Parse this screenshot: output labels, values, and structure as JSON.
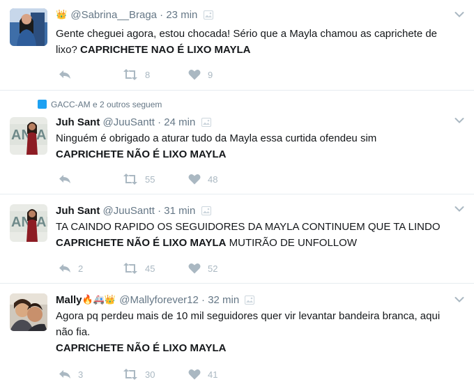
{
  "tweets": [
    {
      "name": "",
      "badges": "👑",
      "handle": "@Sabrina__Braga",
      "separator": "·",
      "time": "23 min",
      "context": "",
      "text_plain": "Gente cheguei agora, estou chocada! Sério que a Mayla chamou as caprichete de lixo? ",
      "text_bold": "CAPRICHETE NAO É LIXO MAYLA",
      "text_after": "",
      "replies": "",
      "retweets": "8",
      "likes": "9"
    },
    {
      "name": "Juh Sant",
      "badges": "",
      "handle": "@JuuSantt",
      "separator": "·",
      "time": "24 min",
      "context": "GACC-AM e 2 outros seguem",
      "text_plain": "Ninguém é obrigado a aturar tudo da Mayla essa curtida ofendeu sim",
      "text_bold": "CAPRICHETE NÃO É LIXO MAYLA",
      "text_after": "",
      "replies": "",
      "retweets": "55",
      "likes": "48"
    },
    {
      "name": "Juh Sant",
      "badges": "",
      "handle": "@JuuSantt",
      "separator": "·",
      "time": "31 min",
      "context": "",
      "text_plain": "TA CAINDO RAPIDO OS SEGUIDORES DA MAYLA CONTINUEM QUE TA LINDO",
      "text_bold": "CAPRICHETE NÃO É LIXO MAYLA",
      "text_after": " MUTIRÃO DE UNFOLLOW",
      "replies": "2",
      "retweets": "45",
      "likes": "52"
    },
    {
      "name": "Mally",
      "badges": "🔥🚑👑",
      "handle": "@Mallyforever12",
      "separator": "·",
      "time": "32 min",
      "context": "",
      "text_plain": "Agora pq perdeu mais de 10 mil seguidores quer vir levantar bandeira branca, aqui não fia.",
      "text_bold": "CAPRICHETE NÃO É LIXO MAYLA",
      "text_after": "",
      "replies": "3",
      "retweets": "30",
      "likes": "41"
    }
  ],
  "colors": {
    "text": "#14171a",
    "muted": "#657786",
    "action": "#aab8c2",
    "divider": "#e6ecf0",
    "context_icon": "#1da1f2"
  },
  "icons": {
    "reply": "reply-icon",
    "retweet": "retweet-icon",
    "like": "heart-icon",
    "caret": "chevron-down-icon",
    "media": "image-icon"
  }
}
